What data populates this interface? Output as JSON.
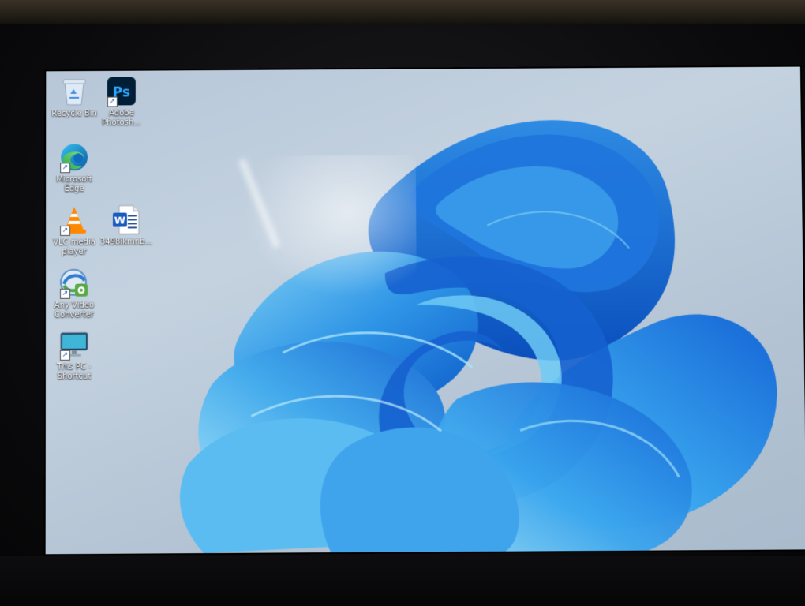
{
  "desktop": {
    "wallpaper": {
      "name": "windows-11-bloom",
      "background_color": "#b9c8d8",
      "accent_color": "#1e6fd9"
    },
    "icons": [
      {
        "id": "recycle-bin",
        "label": "Recycle Bin",
        "icon": "recycle-bin-icon",
        "shortcut": false
      },
      {
        "id": "adobe-photoshop",
        "label": "Adobe\nPhotosh...",
        "icon": "photoshop-icon",
        "shortcut": true
      },
      {
        "id": "microsoft-edge",
        "label": "Microsoft\nEdge",
        "icon": "edge-icon",
        "shortcut": true
      },
      {
        "id": "vlc-media-player",
        "label": "VLC media\nplayer",
        "icon": "vlc-cone-icon",
        "shortcut": true
      },
      {
        "id": "word-document",
        "label": "3498ikmnb...",
        "icon": "word-document-icon",
        "shortcut": false
      },
      {
        "id": "any-video-converter",
        "label": "Any Video\nConverter",
        "icon": "any-video-converter-icon",
        "shortcut": true
      },
      {
        "id": "this-pc",
        "label": "This PC -\nShortcut",
        "icon": "monitor-icon",
        "shortcut": true
      }
    ]
  }
}
